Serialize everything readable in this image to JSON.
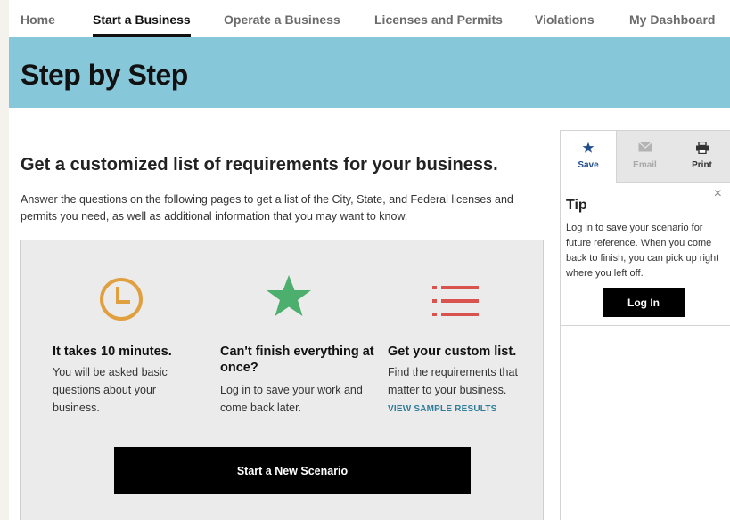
{
  "nav": {
    "items": [
      {
        "label": "Home",
        "active": false
      },
      {
        "label": "Start a Business",
        "active": true
      },
      {
        "label": "Operate a Business",
        "active": false
      },
      {
        "label": "Licenses and Permits",
        "active": false
      },
      {
        "label": "Violations",
        "active": false
      },
      {
        "label": "My Dashboard",
        "active": false
      }
    ]
  },
  "banner": {
    "title": "Step by Step",
    "color": "#86c8da"
  },
  "main": {
    "heading": "Get a customized list of requirements for your business.",
    "intro": "Answer the questions on the following pages to get a list of the City, State, and Federal licenses and permits you need, as well as additional information that you may want to know."
  },
  "features": [
    {
      "icon": "clock-icon",
      "color": "#e0a040",
      "title": "It takes 10 minutes.",
      "text": "You will be asked basic questions about your business."
    },
    {
      "icon": "star-icon",
      "color": "#4caf6e",
      "title": "Can't finish everything at once?",
      "text": "Log in to save your work and come back later."
    },
    {
      "icon": "list-icon",
      "color": "#d9534f",
      "title": "Get your custom list.",
      "text": "Find the requirements that matter to your business.",
      "link": "VIEW SAMPLE RESULTS"
    }
  ],
  "cta": {
    "label": "Start a New Scenario"
  },
  "panel": {
    "tabs": [
      {
        "icon": "star-icon",
        "label": "Save"
      },
      {
        "icon": "envelope-icon",
        "label": "Email"
      },
      {
        "icon": "printer-icon",
        "label": "Print"
      }
    ],
    "tip": {
      "close": "×",
      "title": "Tip",
      "text": "Log in to save your scenario for future reference. When you come back to finish, you can pick up right where you left off.",
      "button": "Log In"
    }
  }
}
